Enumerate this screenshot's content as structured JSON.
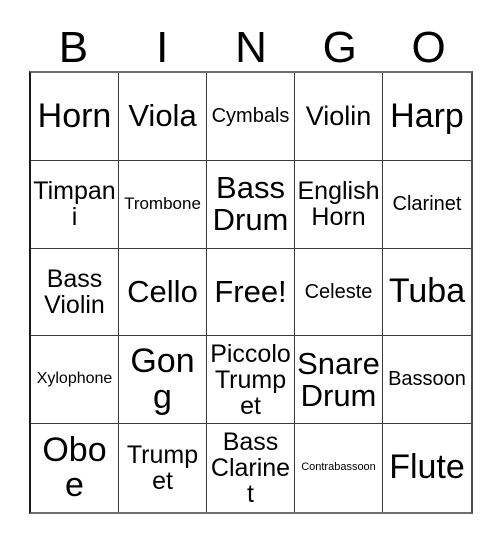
{
  "card": {
    "title": "Bingo Card",
    "header_letters": [
      "B",
      "I",
      "N",
      "G",
      "O"
    ],
    "background_color": "#ffffff",
    "border_color": "#3c3c3c",
    "text_color": "#000000",
    "columns": 5,
    "rows": 5,
    "free_space_label": "Free!",
    "free_space_position": "N3",
    "cells": [
      [
        {
          "label": "Horn",
          "size": "fs-xxl",
          "lines": 1
        },
        {
          "label": "Viola",
          "size": "fs-xl",
          "lines": 1
        },
        {
          "label": "Cymbals",
          "size": "fs-sm",
          "lines": 1
        },
        {
          "label": "Violin",
          "size": "fs-lg",
          "lines": 1
        },
        {
          "label": "Harp",
          "size": "fs-xxl",
          "lines": 1
        }
      ],
      [
        {
          "label": "Timpani",
          "size": "fs-md",
          "lines": 1
        },
        {
          "label": "Trombone",
          "size": "fs-xs",
          "lines": 1
        },
        {
          "label": "Bass\nDrum",
          "size": "fs-xl",
          "lines": 2
        },
        {
          "label": "English\nHorn",
          "size": "fs-md",
          "lines": 2
        },
        {
          "label": "Clarinet",
          "size": "fs-sm",
          "lines": 1
        }
      ],
      [
        {
          "label": "Bass\nViolin",
          "size": "fs-md",
          "lines": 2
        },
        {
          "label": "Cello",
          "size": "fs-xl",
          "lines": 1
        },
        {
          "label": "Free!",
          "size": "fs-xl",
          "lines": 1
        },
        {
          "label": "Celeste",
          "size": "fs-sm",
          "lines": 1
        },
        {
          "label": "Tuba",
          "size": "fs-xxl",
          "lines": 1
        }
      ],
      [
        {
          "label": "Xylophone",
          "size": "fs-xxs",
          "lines": 1
        },
        {
          "label": "Gong",
          "size": "fs-xxl",
          "lines": 1
        },
        {
          "label": "Piccolo\nTrumpet",
          "size": "fs-md",
          "lines": 2
        },
        {
          "label": "Snare\nDrum",
          "size": "fs-xl",
          "lines": 2
        },
        {
          "label": "Bassoon",
          "size": "fs-sm",
          "lines": 1
        }
      ],
      [
        {
          "label": "Oboe",
          "size": "fs-xxl",
          "lines": 1
        },
        {
          "label": "Trumpet",
          "size": "fs-md",
          "lines": 1
        },
        {
          "label": "Bass\nClarinet",
          "size": "fs-md",
          "lines": 2
        },
        {
          "label": "Contrabassoon",
          "size": "fs-tiny",
          "lines": 1
        },
        {
          "label": "Flute",
          "size": "fs-xxl",
          "lines": 1
        }
      ]
    ]
  }
}
